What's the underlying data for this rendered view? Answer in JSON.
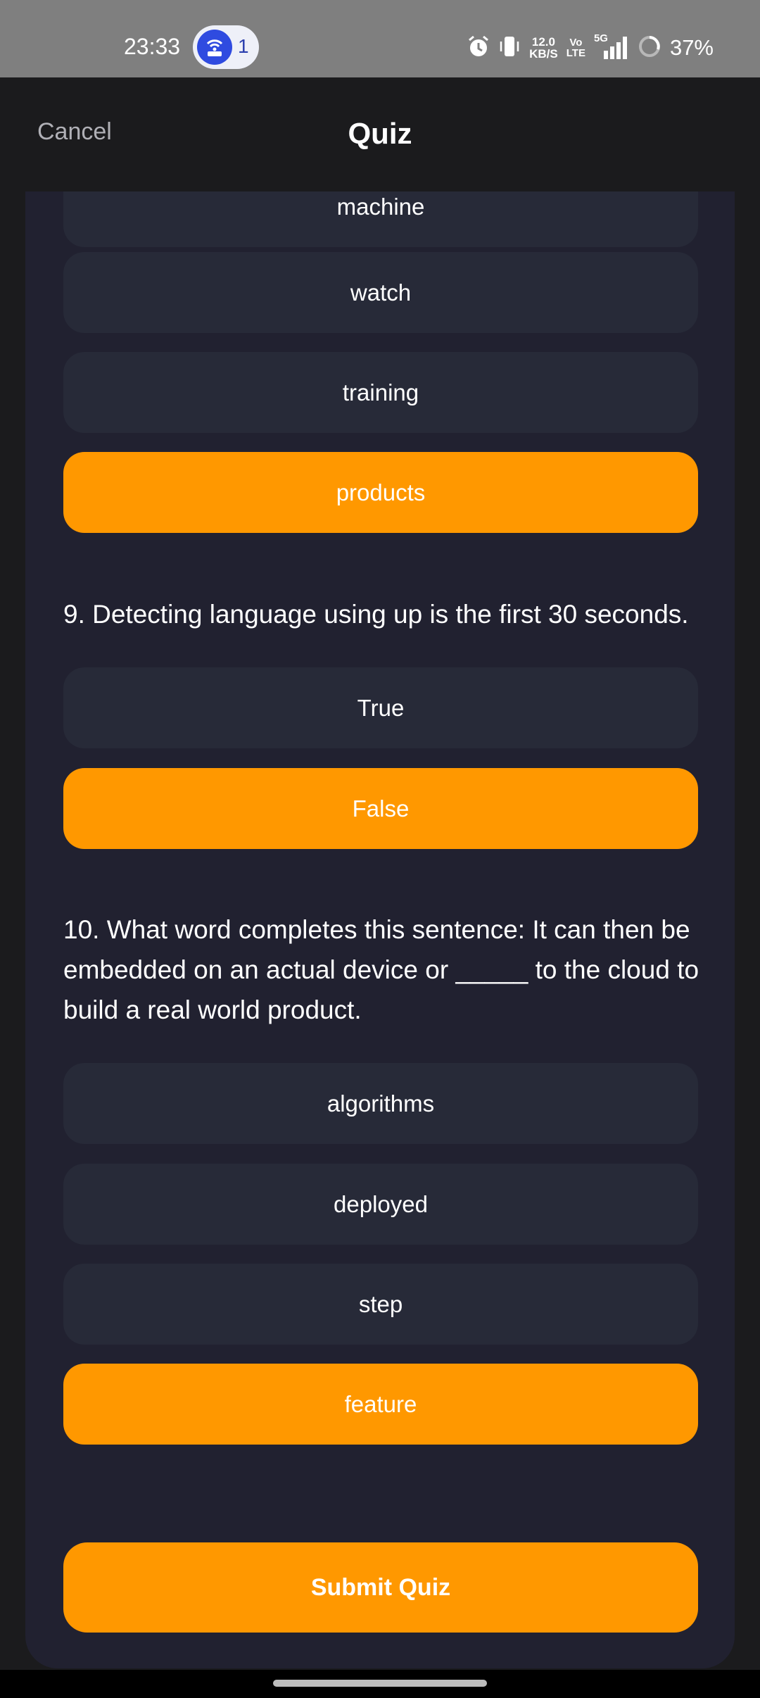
{
  "status_bar": {
    "time": "23:33",
    "hotspot_count": "1",
    "net_speed_value": "12.0",
    "net_speed_unit": "KB/S",
    "volte_top": "Vo",
    "volte_bottom": "LTE",
    "network": "5G",
    "battery": "37%"
  },
  "header": {
    "cancel_label": "Cancel",
    "title": "Quiz"
  },
  "question8_options": [
    {
      "label": "machine",
      "selected": false
    },
    {
      "label": "watch",
      "selected": false
    },
    {
      "label": "training",
      "selected": false
    },
    {
      "label": "products",
      "selected": true
    }
  ],
  "question9": {
    "text": "9. Detecting language using up is the first 30 seconds.",
    "options": [
      {
        "label": "True",
        "selected": false
      },
      {
        "label": "False",
        "selected": true
      }
    ]
  },
  "question10": {
    "text": "10. What word completes this sentence: It can then be embedded on an actual device or _____ to the cloud to build a real world product.",
    "options": [
      {
        "label": "algorithms",
        "selected": false
      },
      {
        "label": "deployed",
        "selected": false
      },
      {
        "label": "step",
        "selected": false
      },
      {
        "label": "feature",
        "selected": true
      }
    ]
  },
  "submit_label": "Submit Quiz",
  "colors": {
    "accent": "#ff9800",
    "card": "#212130",
    "option": "#272a38",
    "background": "#1b1b1d"
  }
}
